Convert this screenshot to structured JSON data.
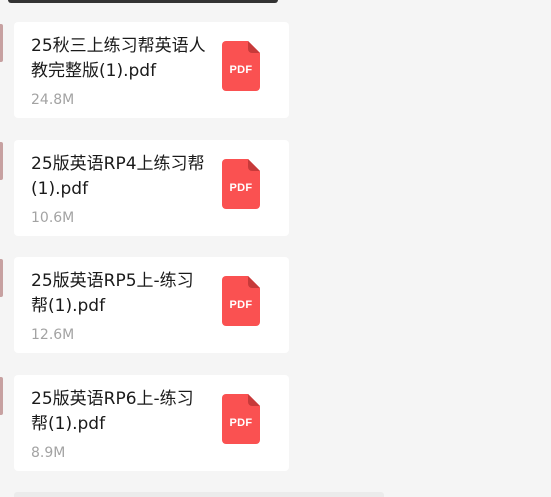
{
  "files": [
    {
      "name": "25秋三上练习帮英语人教完整版(1).pdf",
      "size": "24.8M",
      "icon": "pdf-file-icon",
      "icon_label": "PDF"
    },
    {
      "name": "25版英语RP4上练习帮(1).pdf",
      "size": "10.6M",
      "icon": "pdf-file-icon",
      "icon_label": "PDF"
    },
    {
      "name": "25版英语RP5上-练习帮(1).pdf",
      "size": "12.6M",
      "icon": "pdf-file-icon",
      "icon_label": "PDF"
    },
    {
      "name": "25版英语RP6上-练习帮(1).pdf",
      "size": "8.9M",
      "icon": "pdf-file-icon",
      "icon_label": "PDF"
    }
  ],
  "colors": {
    "background": "#f5f5f5",
    "card": "#ffffff",
    "pdf_red": "#fa5151",
    "pdf_fold": "#c73a3a",
    "size_text": "#a3a3a3"
  }
}
